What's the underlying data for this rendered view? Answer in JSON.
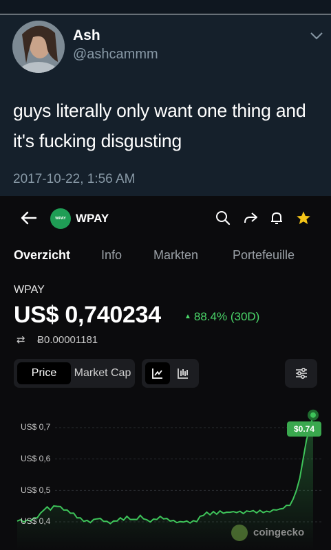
{
  "tweet": {
    "name": "Ash",
    "handle": "@ashcammm",
    "text": "guys literally only want one thing and it's fucking disgusting",
    "timestamp": "2017-10-22, 1:56 AM"
  },
  "app": {
    "coin_logo_text": "WPAY",
    "coin_name": "WPAY",
    "tabs": [
      {
        "label": "Overzicht",
        "active": true
      },
      {
        "label": "Info",
        "active": false
      },
      {
        "label": "Markten",
        "active": false
      },
      {
        "label": "Portefeuille",
        "active": false
      }
    ],
    "symbol": "WPAY",
    "price": "US$ 0,740234",
    "change": "88.4% (30D)",
    "btc_price": "Ƀ0.00001181",
    "toggles": {
      "price_label": "Price",
      "market_cap_label": "Market Cap"
    },
    "watermark": "coingecko",
    "colors": {
      "up": "#4bd86a",
      "line": "#3ec45a",
      "badge": "#3aa84e"
    }
  },
  "chart_data": {
    "type": "line",
    "yticks": [
      "US$ 0,7",
      "US$ 0,6",
      "US$ 0,5",
      "US$ 0,4"
    ],
    "ylim": [
      0.38,
      0.78
    ],
    "last_label": "$0.74",
    "values": [
      0.405,
      0.404,
      0.402,
      0.403,
      0.405,
      0.41,
      0.415,
      0.425,
      0.44,
      0.445,
      0.44,
      0.448,
      0.452,
      0.446,
      0.44,
      0.435,
      0.43,
      0.425,
      0.415,
      0.41,
      0.404,
      0.402,
      0.4,
      0.405,
      0.412,
      0.408,
      0.404,
      0.399,
      0.397,
      0.4,
      0.405,
      0.41,
      0.408,
      0.415,
      0.41,
      0.405,
      0.41,
      0.418,
      0.412,
      0.404,
      0.402,
      0.406,
      0.41,
      0.415,
      0.412,
      0.408,
      0.405,
      0.402,
      0.4,
      0.398,
      0.402,
      0.4,
      0.399,
      0.401,
      0.403,
      0.415,
      0.423,
      0.428,
      0.425,
      0.43,
      0.427,
      0.432,
      0.43,
      0.428,
      0.433,
      0.43,
      0.432,
      0.431,
      0.429,
      0.432,
      0.435,
      0.433,
      0.431,
      0.434,
      0.432,
      0.431,
      0.434,
      0.436,
      0.44,
      0.438,
      0.445,
      0.45,
      0.455,
      0.47,
      0.5,
      0.54,
      0.6,
      0.66,
      0.7,
      0.74
    ]
  }
}
